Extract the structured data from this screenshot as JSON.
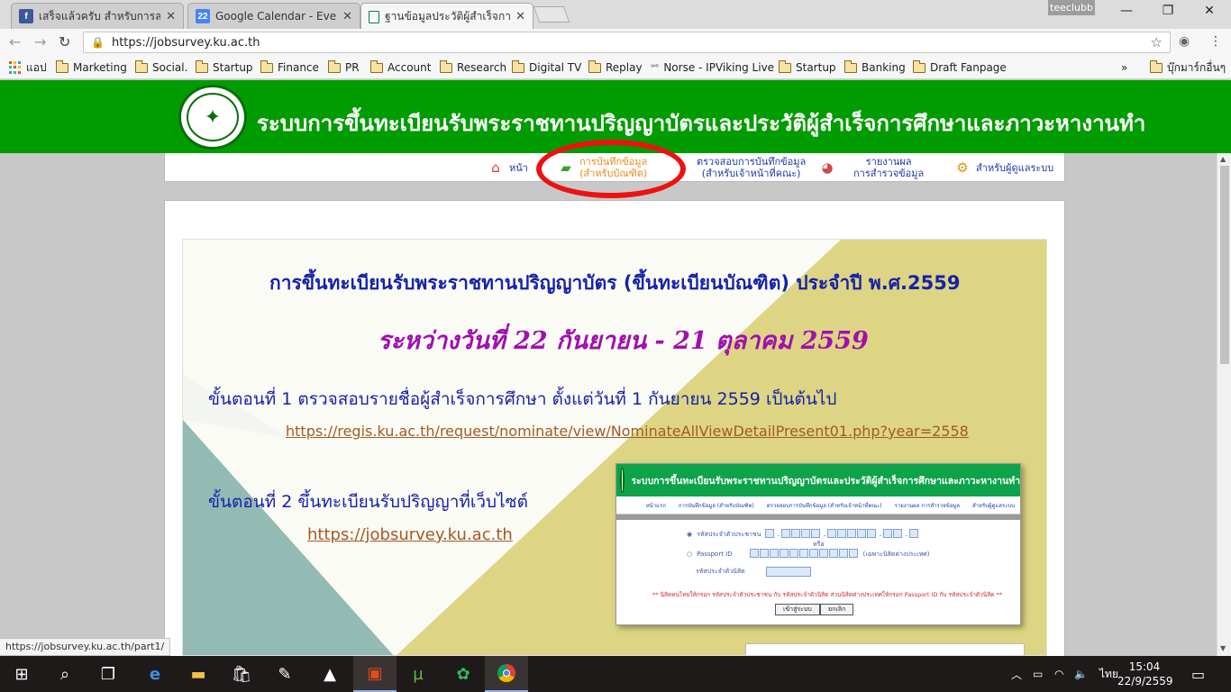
{
  "browser": {
    "tabs": [
      {
        "title": "เสร็จแล้วครับ สำหรับการลงท",
        "favicon": "f",
        "favicon_color": "#3b5998",
        "active": false
      },
      {
        "title": "Google Calendar - Event",
        "favicon": "22",
        "favicon_color": "#4285f4",
        "active": false
      },
      {
        "title": "ฐานข้อมูลประวัติผู้สำเร็จการศึ",
        "favicon": "",
        "favicon_color": "#0b8043",
        "active": true
      }
    ],
    "profile_name": "teeclubb",
    "url": "https://jobsurvey.ku.ac.th",
    "status_url": "https://jobsurvey.ku.ac.th/part1/"
  },
  "bookmarks": {
    "apps_label": "แอป",
    "items": [
      {
        "label": "Marketing"
      },
      {
        "label": "Social."
      },
      {
        "label": "Startup"
      },
      {
        "label": "Finance"
      },
      {
        "label": "PR"
      },
      {
        "label": "Account"
      },
      {
        "label": "Research"
      },
      {
        "label": "Digital TV"
      },
      {
        "label": "Replay"
      },
      {
        "label": "Norse - IPViking Live"
      },
      {
        "label": "Startup"
      },
      {
        "label": "Banking"
      },
      {
        "label": "Draft Fanpage"
      }
    ],
    "overflow": "»",
    "other": "บุ๊กมาร์กอื่นๆ"
  },
  "site": {
    "title": "ระบบการขึ้นทะเบียนรับพระราชทานปริญญาบัตรและประวัติผู้สำเร็จการศึกษาและภาวะหางานทำ",
    "menu": {
      "home": "หน้า",
      "record_line1": "การบันทึกข้อมูล",
      "record_line2": "(สำหรับบัณฑิต)",
      "check_line1": "ตรวจสอบการบันทึกข้อมูล",
      "check_line2": "(สำหรับเจ้าหน้าที่คณะ)",
      "report_line1": "รายงานผล",
      "report_line2": "การสำรวจข้อมูล",
      "admin": "สำหรับผู้ดูแลระบบ"
    },
    "accent_color": "#019c01",
    "highlight_color": "#ee1111"
  },
  "banner": {
    "heading": "การขึ้นทะเบียนรับพระราชทานปริญญาบัตร (ขึ้นทะเบียนบัณฑิต) ประจำปี พ.ศ.2559",
    "date_range": "ระหว่างวันที่  22 กันยายน - 21 ตุลาคม 2559",
    "step1": "ขั้นตอนที่ 1 ตรวจสอบรายชื่อผู้สำเร็จการศึกษา ตั้งแต่วันที่ 1 กันยายน 2559 เป็นต้นไป",
    "step1_link": "https://regis.ku.ac.th/request/nominate/view/NominateAllViewDetailPresent01.php?year=2558",
    "step2": "ขั้นตอนที่ 2 ขึ้นทะเบียนรับปริญญาที่เว็บไซต์",
    "step2_link": "https://jobsurvey.ku.ac.th"
  },
  "screenshot": {
    "title": "ระบบการขึ้นทะเบียนรับพระราชทานปริญญาบัตรและประวัติผู้สำเร็จการศึกษาและภาวะหางานทำ",
    "menu": [
      "หน้าแรก",
      "การบันทึกข้อมูล (สำหรับบัณฑิต)",
      "ตรวจสอบการบันทึกข้อมูล (สำหรับเจ้าหน้าที่คณะ)",
      "รายงานผล การสำรวจข้อมูล",
      "สำหรับผู้ดูแลระบบ"
    ],
    "id_label": "รหัสประจำตัวประชาชน",
    "or_label": "หรือ",
    "passport_label": "Passport ID",
    "passport_hint": "(เฉพาะนิสิตต่างประเทศ)",
    "student_label": "รหัสประจำตัวนิสิต",
    "note": "** นิสิตคนไทยให้กรอก รหัสประจำตัวประชาชน กับ รหัสประจำตัวนิสิต ส่วนนิสิตต่างประเทศให้กรอก Passport ID กับ รหัสประจำตัวนิสิต **",
    "login_button": "เข้าสู่ระบบ",
    "cancel_button": "ยกเลิก"
  },
  "taskbar": {
    "language": "ไทย",
    "time": "15:04",
    "date": "22/9/2559"
  }
}
